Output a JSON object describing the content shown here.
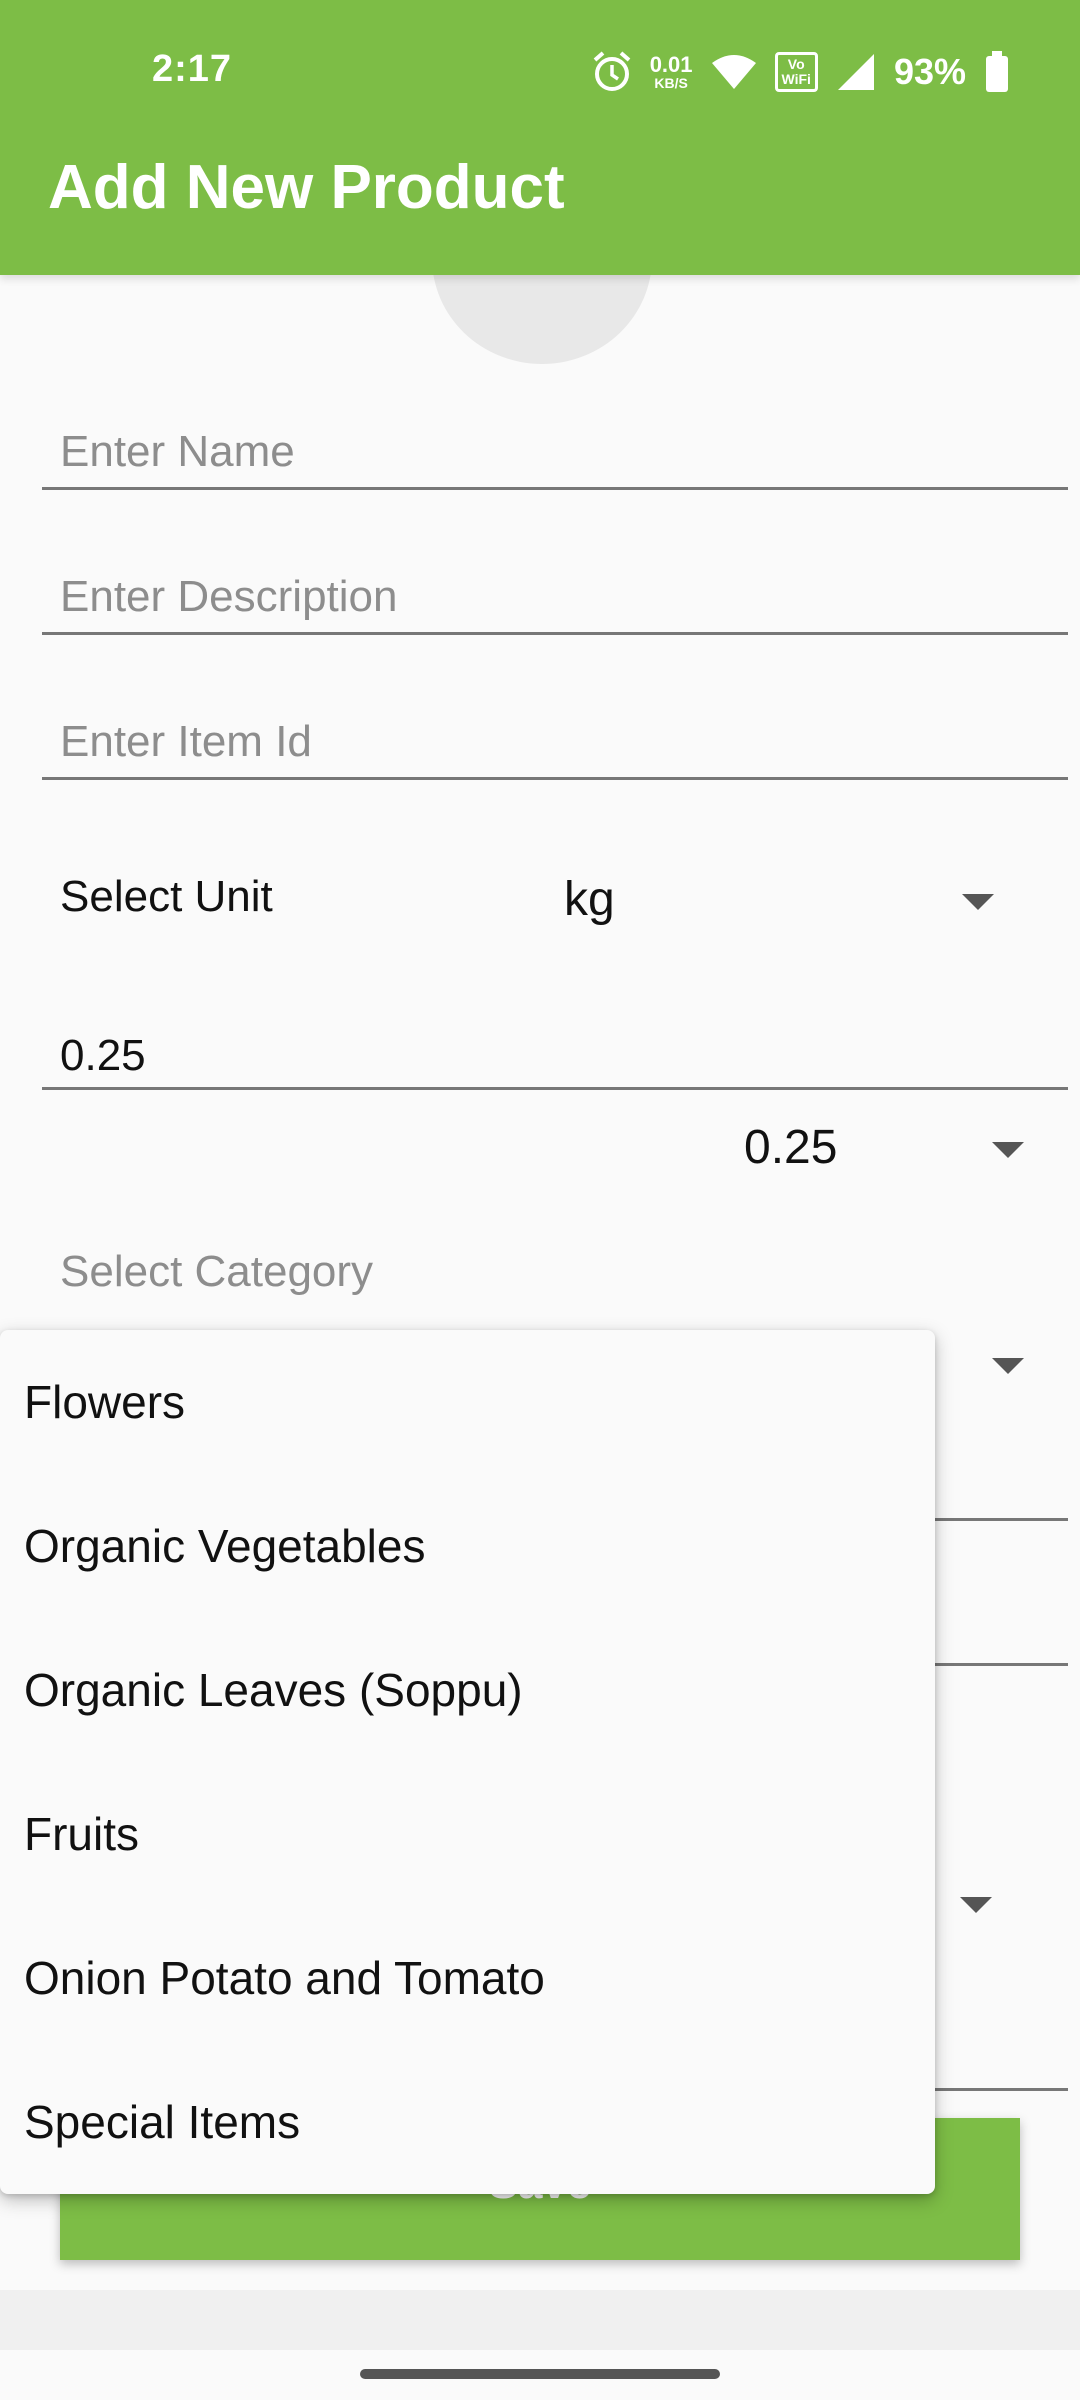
{
  "status": {
    "time": "2:17",
    "net_speed_value": "0.01",
    "net_speed_unit": "KB/S",
    "vowifi_top": "Vo",
    "vowifi_bottom": "WiFi",
    "battery": "93%"
  },
  "header": {
    "title": "Add New Product"
  },
  "form": {
    "name_placeholder": "Enter Name",
    "description_placeholder": "Enter Description",
    "item_id_placeholder": "Enter Item Id",
    "unit_label": "Select Unit",
    "unit_value": "kg",
    "quantity_value": "0.25",
    "quantity_dropdown_value": "0.25",
    "category_label": "Select Category",
    "save_label": "Save"
  },
  "category_menu": {
    "items": [
      "Flowers",
      "Organic Vegetables",
      "Organic Leaves (Soppu)",
      "Fruits",
      "Onion Potato and Tomato",
      "Special Items"
    ]
  },
  "colors": {
    "accent": "#7dbd46"
  }
}
